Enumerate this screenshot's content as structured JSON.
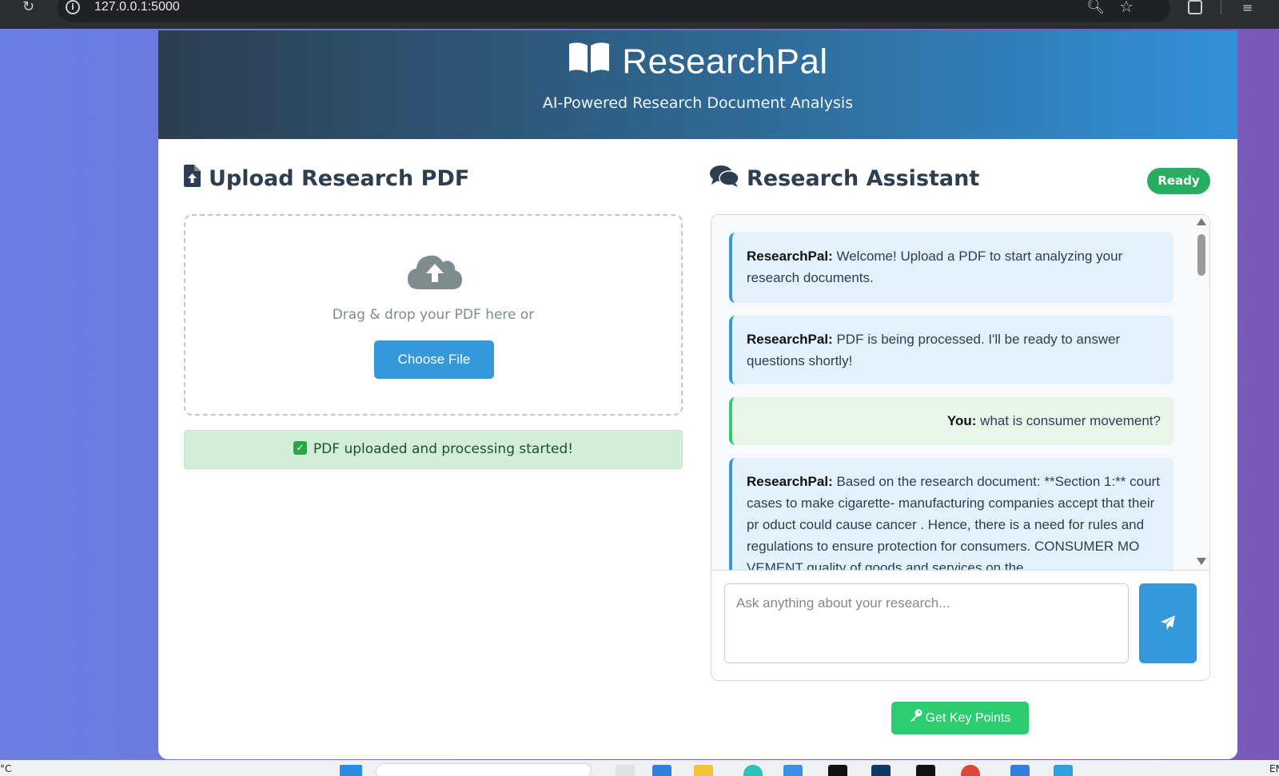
{
  "browser": {
    "url": "127.0.0.1:5000"
  },
  "header": {
    "brand": "ResearchPal",
    "tagline": "AI-Powered Research Document Analysis"
  },
  "upload": {
    "title": "Upload Research PDF",
    "drop_text": "Drag & drop your PDF here or",
    "choose_label": "Choose File",
    "status": "PDF uploaded and processing started!"
  },
  "assistant": {
    "title": "Research Assistant",
    "status_badge": "Ready",
    "messages": [
      {
        "sender": "ResearchPal:",
        "text": "Welcome! Upload a PDF to start analyzing your research documents.",
        "role": "bot"
      },
      {
        "sender": "ResearchPal:",
        "text": "PDF is being processed. I'll be ready to answer questions shortly!",
        "role": "bot"
      },
      {
        "sender": "You:",
        "text": "what is consumer movement?",
        "role": "user"
      },
      {
        "sender": "ResearchPal:",
        "text": "Based on the research document: **Section 1:** court cases to make cigarette- manufacturing companies accept that their pr oduct could cause cancer . Hence, there is a need for rules and regulations to ensure protection for consumers. CONSUMER MO VEMENT quality of goods and services on the",
        "role": "bot"
      }
    ],
    "input_placeholder": "Ask anything about your research...",
    "keypoints_label": "Get Key Points"
  },
  "taskbar": {
    "temperature": "°C",
    "language": "EN"
  },
  "colors": {
    "primary": "#3498db",
    "success": "#2ecc71",
    "ready": "#27ae60",
    "header_dark": "#2c3e50"
  }
}
